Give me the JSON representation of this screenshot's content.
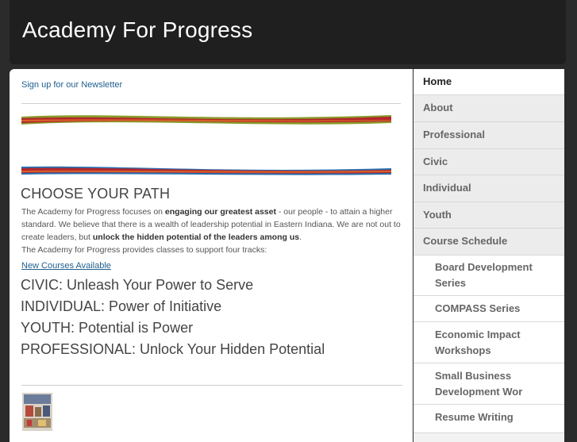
{
  "header": {
    "title": "Academy For Progress"
  },
  "main": {
    "newsletter_link": "Sign up for our Newsletter",
    "heading": "CHOOSE YOUR PATH",
    "intro": {
      "p1_a": "The Academy for Progress focuses on ",
      "p1_b": "engaging our greatest asset",
      "p1_c": " - our people - to attain a higher standard. We believe that there is a wealth of leadership potential in Eastern Indiana. We are not out to create leaders, but ",
      "p1_d": "unlock the hidden potential of the leaders among us",
      "p1_e": ".",
      "p2": "The Academy for Progress provides classes to support four tracks:"
    },
    "new_courses_link": "New Courses Available",
    "tracks": [
      "CIVIC: Unleash Your Power to Serve",
      "INDIVIDUAL: Power of Initiative",
      "YOUTH: Potential is Power",
      "PROFESSIONAL: Unlock Your Hidden Potential"
    ]
  },
  "sidebar": {
    "items": [
      {
        "label": "Home"
      },
      {
        "label": "About"
      },
      {
        "label": "Professional"
      },
      {
        "label": "Civic"
      },
      {
        "label": "Individual"
      },
      {
        "label": "Youth"
      },
      {
        "label": "Course Schedule"
      }
    ],
    "sub_items": [
      {
        "label": "Board Development Series"
      },
      {
        "label": "COMPASS Series"
      },
      {
        "label": "Economic Impact Workshops"
      },
      {
        "label": "Small Business Development Wor"
      },
      {
        "label": "Resume Writing"
      }
    ]
  },
  "colors": {
    "ribbon_red": "#b3262a",
    "ribbon_green": "#8a9a2a",
    "ribbon_blue": "#2a6fb0",
    "ribbon_orange": "#d9612a"
  }
}
